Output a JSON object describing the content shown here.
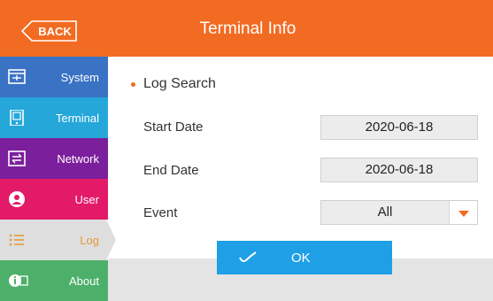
{
  "header": {
    "back_label": "BACK",
    "title": "Terminal Info",
    "color": "#f26b22"
  },
  "sidebar": {
    "items": [
      {
        "label": "System",
        "icon": "system-icon",
        "color": "#3a72c4"
      },
      {
        "label": "Terminal",
        "icon": "terminal-icon",
        "color": "#25a7da"
      },
      {
        "label": "Network",
        "icon": "network-icon",
        "color": "#7b1f9c"
      },
      {
        "label": "User",
        "icon": "user-icon",
        "color": "#e21a68"
      },
      {
        "label": "Log",
        "icon": "log-icon",
        "color": "#dedede",
        "selected": true
      },
      {
        "label": "About",
        "icon": "about-icon",
        "color": "#4db06a"
      }
    ]
  },
  "main": {
    "section_title": "Log Search",
    "start_date_label": "Start Date",
    "start_date_value": "2020-06-18",
    "end_date_label": "End Date",
    "end_date_value": "2020-06-18",
    "event_label": "Event",
    "event_value": "All",
    "ok_label": "OK",
    "accent": "#1e9fe6"
  }
}
